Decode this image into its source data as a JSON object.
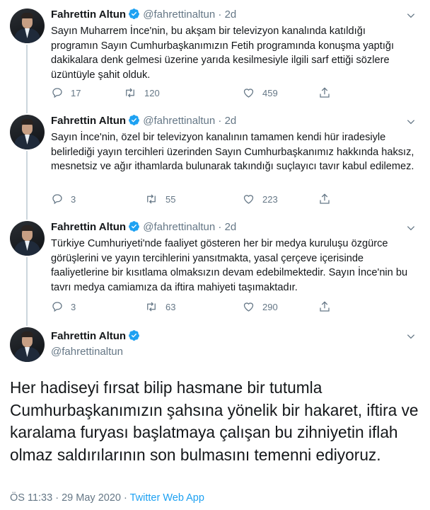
{
  "author": {
    "name": "Fahrettin Altun",
    "handle": "@fahrettinaltun",
    "verified": true
  },
  "separator": "·",
  "replies": [
    {
      "age": "2d",
      "text": "Sayın Muharrem İnce'nin, bu akşam bir televizyon kanalında katıldığı programın Sayın Cumhurbaşkanımızın Fetih programında konuşma yaptığı dakikalara denk gelmesi üzerine yarıda kesilmesiyle ilgili sarf ettiği sözlere üzüntüyle şahit olduk.",
      "reply_count": "17",
      "retweet_count": "120",
      "like_count": "459"
    },
    {
      "age": "2d",
      "text": "Sayın İnce'nin, özel bir televizyon kanalının tamamen kendi hür iradesiyle belirlediği yayın tercihleri üzerinden Sayın Cumhurbaşkanımız hakkında haksız, mesnetsiz ve ağır ithamlarda bulunarak takındığı suçlayıcı tavır kabul edilemez.",
      "reply_count": "3",
      "retweet_count": "55",
      "like_count": "223"
    },
    {
      "age": "2d",
      "text": "Türkiye Cumhuriyeti'nde faaliyet gösteren her bir medya kuruluşu özgürce görüşlerini ve yayın tercihlerini yansıtmakta, yasal çerçeve içerisinde faaliyetlerine bir kısıtlama olmaksızın devam edebilmektedir. Sayın İnce'nin bu tavrı medya camiamıza da iftira mahiyeti taşımaktadır.",
      "reply_count": "3",
      "retweet_count": "63",
      "like_count": "290"
    }
  ],
  "main_tweet": {
    "text": "Her hadiseyi fırsat bilip hasmane bir tutumla Cumhurbaşkanımızın şahsına yönelik bir hakaret, iftira ve karalama furyası başlatmaya çalışan bu zihniyetin iflah olmaz saldırılarının son bulmasını temenni ediyoruz.",
    "time": "ÖS 11:33",
    "date": "29 May 2020",
    "source": "Twitter Web App"
  },
  "colors": {
    "text": "#14171a",
    "muted": "#657786",
    "accent": "#1da1f2",
    "thread_line": "#ccd6dd"
  },
  "icons": [
    "chevron-down-icon",
    "verified-badge-icon",
    "reply-icon",
    "retweet-icon",
    "like-icon",
    "share-icon"
  ]
}
